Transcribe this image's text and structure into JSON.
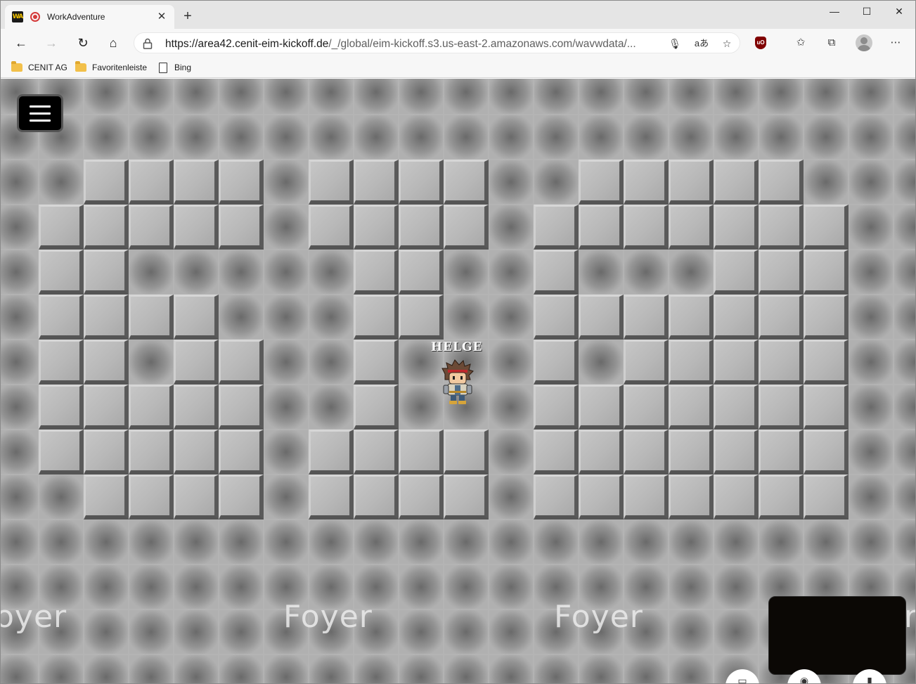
{
  "browser": {
    "tab": {
      "favicon": "WA",
      "title": "WorkAdventure"
    },
    "url": {
      "host": "https://area42.cenit-eim-kickoff.de",
      "path": "/_/global/eim-kickoff.s3.us-east-2.amazonaws.com/wavwdata/..."
    },
    "bookmarks": [
      {
        "label": "CENIT AG",
        "icon": "folder-icon"
      },
      {
        "label": "Favoritenleiste",
        "icon": "folder-icon"
      },
      {
        "label": "Bing",
        "icon": "page-icon"
      }
    ]
  },
  "game": {
    "player_name": "HELGE",
    "zone_labels": [
      "oyer",
      "Foyer",
      "Foyer",
      "r"
    ]
  },
  "colors": {
    "floor": "#9a9a9a",
    "wall": "#bdbdbd",
    "wall_shadow": "#555555",
    "menu_button": "#000000",
    "video_box": "#0b0805"
  }
}
